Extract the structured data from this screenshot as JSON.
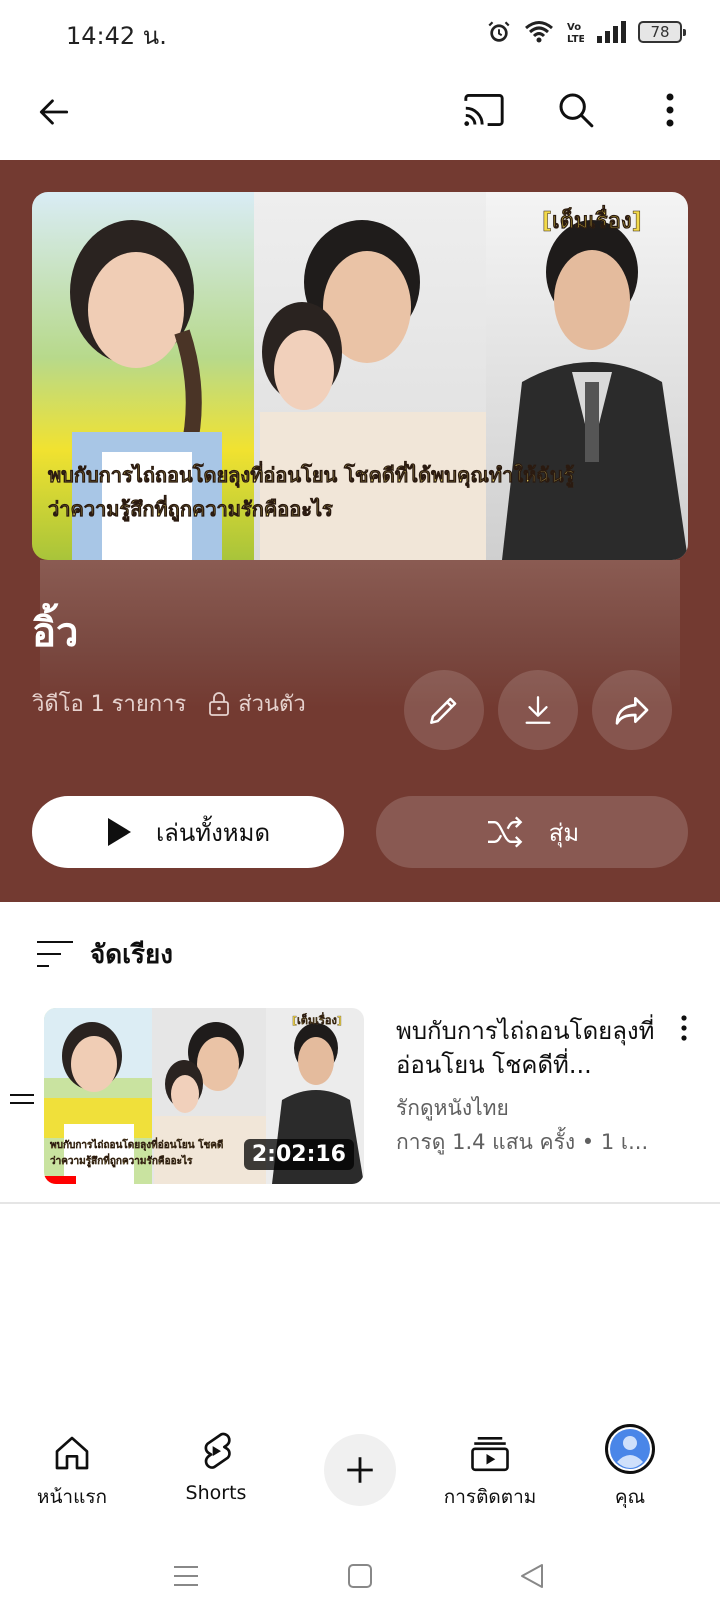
{
  "status_bar": {
    "time": "14:42 น.",
    "battery": "78",
    "icons": [
      "alarm-icon",
      "wifi-icon",
      "volte-icon",
      "signal-icon",
      "battery-icon"
    ]
  },
  "app_bar": {
    "icons": [
      "back-arrow-icon",
      "cast-icon",
      "search-icon",
      "more-vert-icon"
    ]
  },
  "playlist": {
    "title": "อิ้ว",
    "video_count": "วิดีโอ 1 รายการ",
    "privacy": "ส่วนตัว",
    "header_color": "#733a31",
    "hero_thumbnail": {
      "badge": "[เต็มเรื่อง]",
      "caption_line1": "พบกับการไถ่ถอนโดยลุงที่อ่อนโยน โชคดีที่ได้พบคุณทำให้ฉันรู้",
      "caption_line2": "ว่าความรู้สึกที่ถูกความรักคืออะไร"
    },
    "actions": {
      "edit_icon": "pencil-icon",
      "download_icon": "download-icon",
      "share_icon": "share-icon"
    },
    "play_all_label": "เล่นทั้งหมด",
    "shuffle_label": "สุ่ม"
  },
  "sort": {
    "label": "จัดเรียง"
  },
  "videos": [
    {
      "title": "พบกับการไถ่ถอนโดยลุงที่อ่อนโยน โชคดีที่...",
      "channel": "รักดูหนังไทย",
      "views": "การดู 1.4 แสน ครั้ง • 1 เ...",
      "duration": "2:02:16",
      "watch_progress_fraction": 0.1,
      "thumb_badge": "[เต็มเรื่อง]",
      "thumb_caption_line1": "พบกับการไถ่ถอนโดยลุงที่อ่อนโยน โชคดี",
      "thumb_caption_line2": "ว่าความรู้สึกที่ถูกความรักคืออะไร"
    }
  ],
  "bottom_nav": {
    "home": "หน้าแรก",
    "shorts": "Shorts",
    "subscriptions": "การติดตาม",
    "you": "คุณ"
  }
}
